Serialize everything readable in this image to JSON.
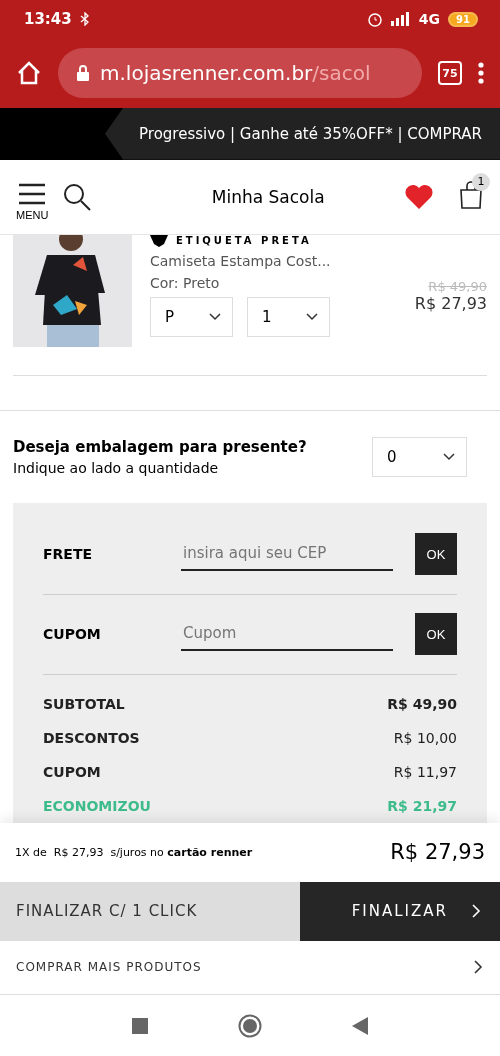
{
  "status_bar": {
    "time": "13:43",
    "network": "4G",
    "battery": "91"
  },
  "browser": {
    "url_host": "m.lojasrenner.com.br",
    "url_path": "/sacol",
    "tab_count": "75"
  },
  "promo": {
    "text": "Progressivo | Ganhe até 35%OFF* | COMPRAR"
  },
  "header": {
    "menu_label": "MENU",
    "title": "Minha Sacola",
    "bag_count": "1"
  },
  "product": {
    "brand": "ETIQUETA PRETA",
    "name": "Camiseta Estampa Cost...",
    "color_label": "Cor: Preto",
    "size": "P",
    "quantity": "1",
    "old_price": "R$ 49,90",
    "price": "R$ 27,93"
  },
  "gift": {
    "question": "Deseja embalagem para presente?",
    "hint": "Indique ao lado a quantidade",
    "quantity": "0"
  },
  "summary": {
    "fields": [
      {
        "label": "FRETE",
        "placeholder": "insira aqui seu CEP",
        "button": "OK"
      },
      {
        "label": "CUPOM",
        "placeholder": "Cupom",
        "button": "OK"
      }
    ],
    "rows": [
      {
        "label": "SUBTOTAL",
        "value": "R$ 49,90",
        "kind": "bold"
      },
      {
        "label": "DESCONTOS",
        "value": "R$ 10,00",
        "kind": "plain"
      },
      {
        "label": "CUPOM",
        "value": "R$ 11,97",
        "kind": "plain"
      },
      {
        "label": "ECONOMIZOU",
        "value": "R$ 21,97",
        "kind": "savings"
      }
    ]
  },
  "footer": {
    "installments": "1X de  R$ 27,93  s/juros no **cartão renner**",
    "total": "R$ 27,93",
    "one_click": "FINALIZAR C/ 1 CLICK",
    "checkout": "FINALIZAR",
    "more": "COMPRAR MAIS PRODUTOS"
  }
}
